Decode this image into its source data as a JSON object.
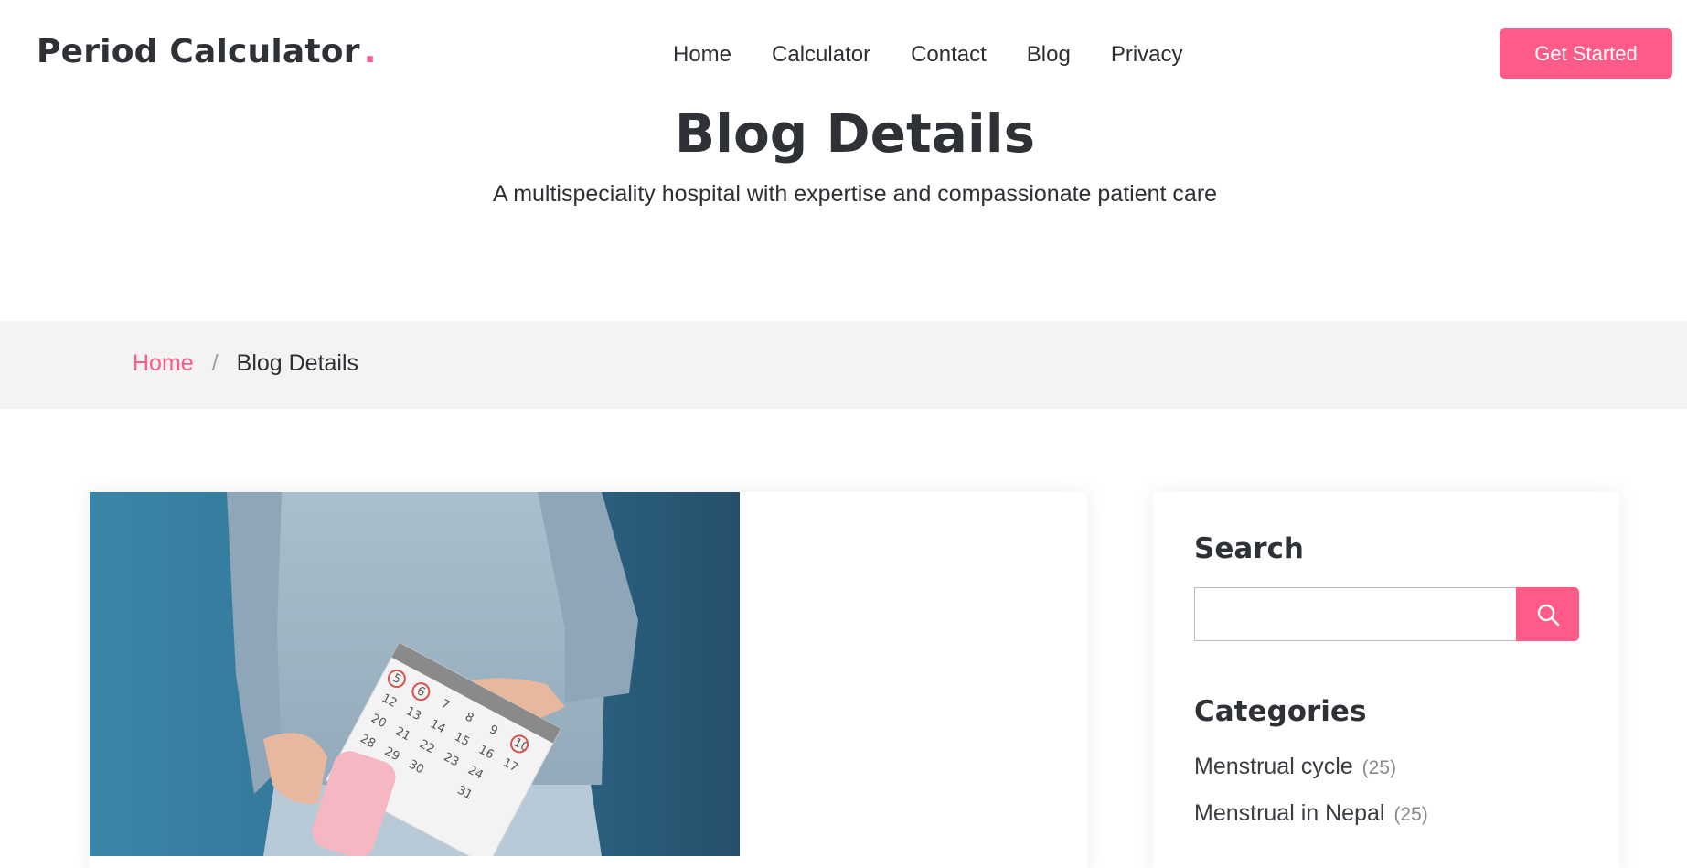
{
  "header": {
    "logo_text": "Period Calculator",
    "logo_dot": ".",
    "nav": [
      {
        "label": "Home"
      },
      {
        "label": "Calculator"
      },
      {
        "label": "Contact"
      },
      {
        "label": "Blog"
      },
      {
        "label": "Privacy"
      }
    ],
    "cta_label": "Get Started"
  },
  "hero": {
    "title": "Blog Details",
    "subtitle": "A multispeciality hospital with expertise and compassionate patient care"
  },
  "breadcrumb": {
    "home": "Home",
    "separator": "/",
    "current": "Blog Details"
  },
  "article": {
    "image_icon": "woman-holding-calendar-and-pad-image"
  },
  "sidebar": {
    "search_title": "Search",
    "search_placeholder": "",
    "search_button_icon": "search-icon",
    "categories_title": "Categories",
    "categories": [
      {
        "label": "Menstrual cycle",
        "count": "(25)"
      },
      {
        "label": "Menstrual in Nepal",
        "count": "(25)"
      }
    ]
  },
  "colors": {
    "accent": "#ff5b89",
    "text_dark": "#2e3136",
    "band_bg": "#f3f3f3",
    "image_bg": "#2f6f91"
  }
}
